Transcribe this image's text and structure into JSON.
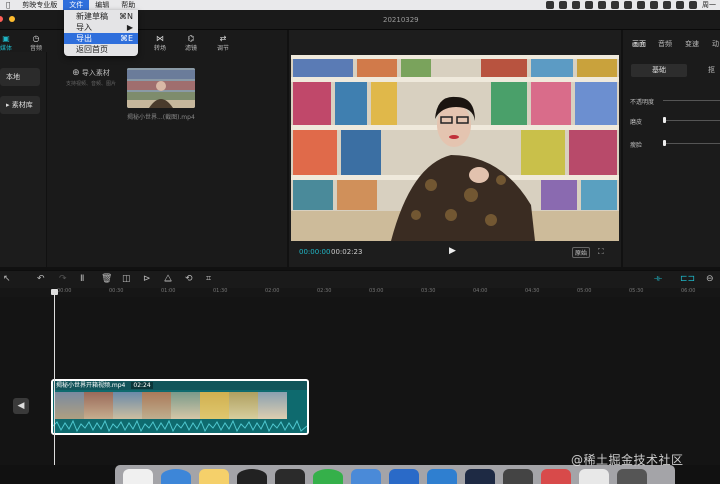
{
  "menubar": {
    "app_name": "剪映专业版",
    "menus": [
      "文件",
      "编辑",
      "帮助"
    ],
    "day": "周一"
  },
  "file_menu": {
    "items": [
      {
        "label": "新建草稿",
        "shortcut": "⌘N"
      },
      {
        "label": "导入",
        "shortcut": "▶"
      },
      {
        "label": "导出",
        "shortcut": "⌘E"
      },
      {
        "label": "返回首页",
        "shortcut": ""
      }
    ]
  },
  "window": {
    "title": "20210329"
  },
  "toolbar": {
    "tabs": [
      {
        "label": "媒体",
        "icon": "media-icon"
      },
      {
        "label": "音频",
        "icon": "audio-icon"
      },
      {
        "label": "转场",
        "icon": "transition-icon"
      },
      {
        "label": "滤镜",
        "icon": "filter-icon"
      },
      {
        "label": "调节",
        "icon": "adjust-icon"
      }
    ]
  },
  "leftnav": {
    "local": "本地",
    "library": "▸ 素材库"
  },
  "media": {
    "import_label": "导入素材",
    "import_hint": "支持视频、音频、图片",
    "clip_name": "揭秘小世界...(截图).mp4"
  },
  "player": {
    "current_time": "00:00:00",
    "total_time": "00:02:23",
    "original_label": "原始"
  },
  "inspector": {
    "tabs": [
      "画面",
      "音频",
      "变速",
      "动"
    ],
    "subtabs": [
      "基础",
      "抠"
    ],
    "props": [
      "不透明度",
      "磨皮",
      "瘦脸"
    ]
  },
  "ruler": {
    "ticks": [
      "00:00",
      "00:30",
      "01:00",
      "01:30",
      "02:00",
      "02:30",
      "03:00",
      "03:30",
      "04:00",
      "04:30",
      "05:00",
      "05:30",
      "06:00"
    ]
  },
  "clip": {
    "name": "揭秘小世界开箱视频.mp4",
    "duration": "02:24"
  },
  "watermark": "@稀土掘金技术社区",
  "colors": {
    "accent": "#1fb6c6",
    "menu_highlight": "#2f6fdc"
  }
}
